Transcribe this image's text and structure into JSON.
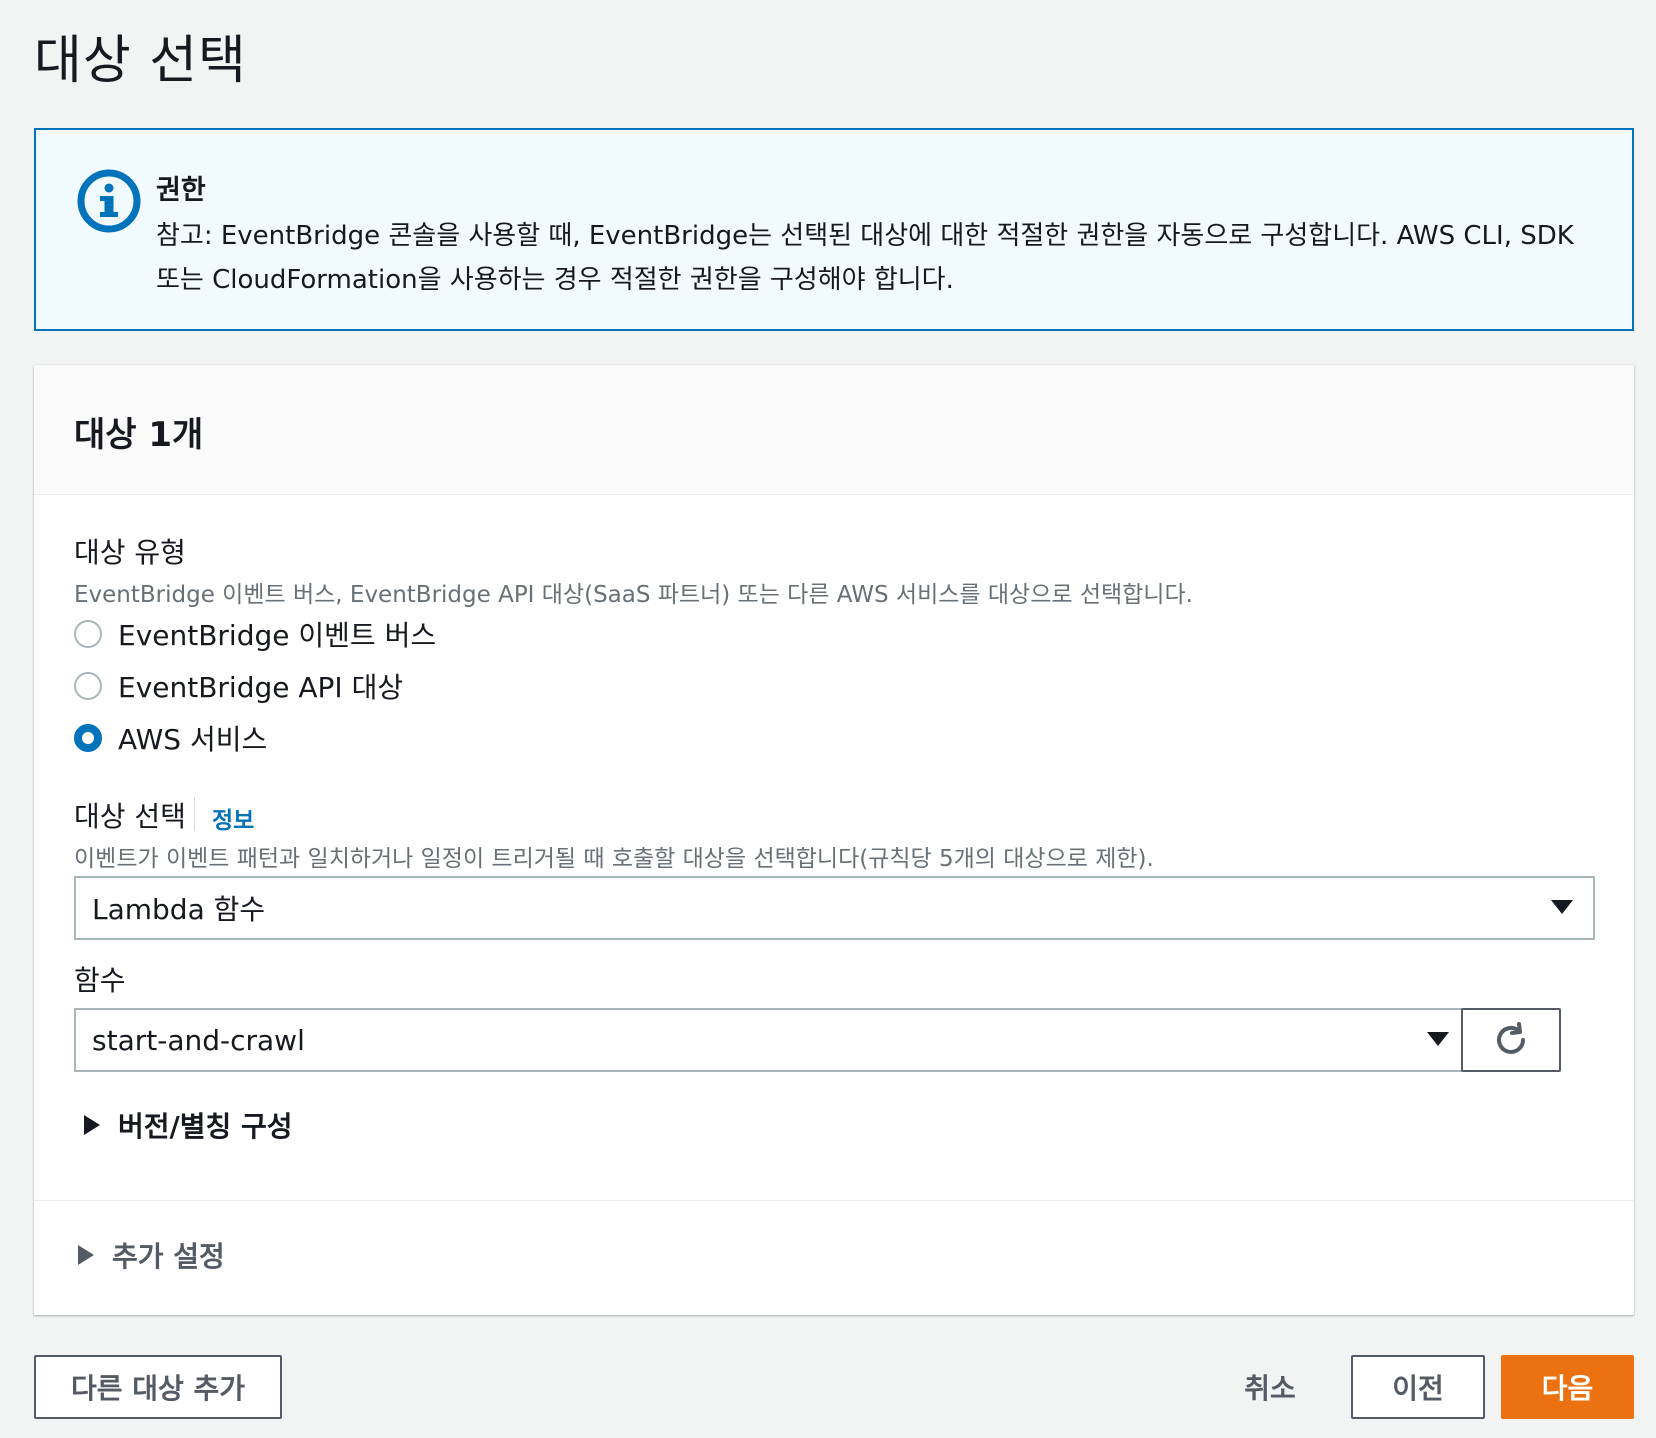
{
  "page": {
    "title": "대상 선택"
  },
  "alert": {
    "title": "권한",
    "body": "참고: EventBridge 콘솔을 사용할 때, EventBridge는 선택된 대상에 대한 적절한 권한을 자동으로 구성합니다. AWS CLI, SDK 또는 CloudFormation을 사용하는 경우 적절한 권한을 구성해야 합니다.",
    "icon": "info-icon",
    "accent": "#0073bb"
  },
  "target": {
    "header": "대상 1개",
    "type_label": "대상 유형",
    "type_desc": "EventBridge 이벤트 버스, EventBridge API 대상(SaaS 파트너) 또는 다른 AWS 서비스를 대상으로 선택합니다.",
    "options": [
      {
        "label": "EventBridge 이벤트 버스",
        "selected": false
      },
      {
        "label": "EventBridge API 대상",
        "selected": false
      },
      {
        "label": "AWS 서비스",
        "selected": true
      }
    ],
    "select_label": "대상 선택",
    "info_link": "정보",
    "select_desc": "이벤트가 이벤트 패턴과 일치하거나 일정이 트리거될 때 호출할 대상을 선택합니다(규칙당 5개의 대상으로 제한).",
    "select_value": "Lambda 함수",
    "function_label": "함수",
    "function_value": "start-and-crawl",
    "version_expander": "버전/별칭 구성",
    "additional_expander": "추가 설정"
  },
  "footer": {
    "add_target": "다른 대상 추가",
    "cancel": "취소",
    "previous": "이전",
    "next": "다음",
    "primary_color": "#ec7211"
  }
}
